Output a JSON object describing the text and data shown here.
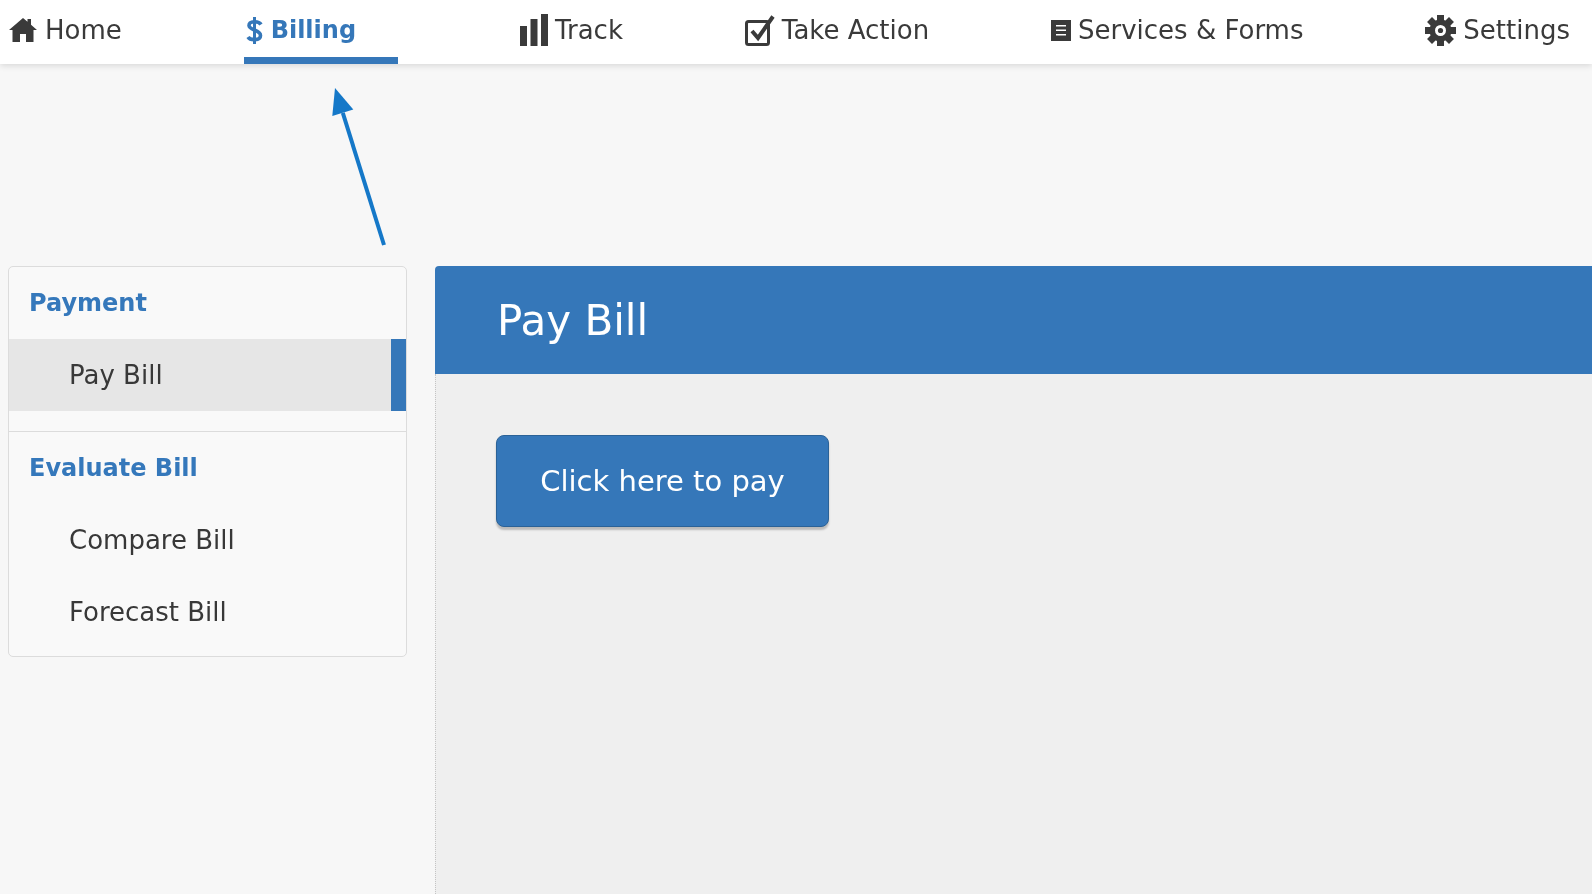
{
  "nav": {
    "tabs": [
      {
        "label": "Home",
        "selected": false
      },
      {
        "label": "Billing",
        "selected": true
      },
      {
        "label": "Track",
        "selected": false
      },
      {
        "label": "Take Action",
        "selected": false
      },
      {
        "label": "Services & Forms",
        "selected": false
      },
      {
        "label": "Settings",
        "selected": false
      }
    ]
  },
  "sidebar": {
    "sections": [
      {
        "heading": "Payment",
        "items": [
          {
            "label": "Pay Bill",
            "selected": true
          }
        ]
      },
      {
        "heading": "Evaluate Bill",
        "items": [
          {
            "label": "Compare Bill",
            "selected": false
          },
          {
            "label": "Forecast Bill",
            "selected": false
          }
        ]
      }
    ]
  },
  "panel": {
    "title": "Pay Bill",
    "button": "Click here to pay"
  }
}
